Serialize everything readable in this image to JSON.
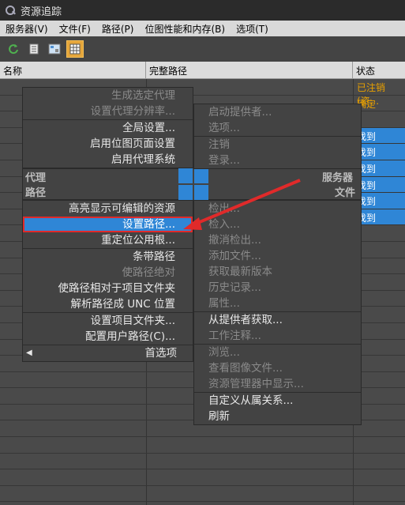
{
  "window": {
    "title": "资源追踪"
  },
  "menu": [
    "服务器(V)",
    "文件(F)",
    "路径(P)",
    "位图性能和内存(B)",
    "选项(T)"
  ],
  "toolbar": [
    "refresh-icon",
    "list-icon",
    "bitmap-icon",
    "table-icon"
  ],
  "columns": {
    "name": "名称",
    "path": "完整路径",
    "status": "状态"
  },
  "row_statuses": [
    "已注销 (资...",
    "确定",
    "",
    "找到",
    "找到",
    "找到",
    "找到",
    "找到",
    "找到"
  ],
  "quad": {
    "top_left_label": "代理",
    "top_right_label": "服务器",
    "bottom_left_label": "路径",
    "bottom_right_label": "文件"
  },
  "left_menu": {
    "items": [
      {
        "label": "生成选定代理",
        "enabled": false
      },
      {
        "label": "设置代理分辨率...",
        "enabled": false
      },
      {
        "sep": true
      },
      {
        "label": "全局设置...",
        "enabled": true
      },
      {
        "label": "启用位图页面设置",
        "enabled": true
      },
      {
        "label": "启用代理系统",
        "enabled": true
      }
    ],
    "items2": [
      {
        "label": "高亮显示可编辑的资源",
        "enabled": true
      },
      {
        "label": "设置路径...",
        "enabled": true,
        "highlight": true
      },
      {
        "label": "重定位公用根...",
        "enabled": true
      },
      {
        "sep": true
      },
      {
        "label": "条带路径",
        "enabled": true
      },
      {
        "label": "使路径绝对",
        "enabled": false
      },
      {
        "label": "使路径相对于项目文件夹",
        "enabled": true
      },
      {
        "label": "解析路径成 UNC 位置",
        "enabled": true
      },
      {
        "sep": true
      },
      {
        "label": "设置项目文件夹...",
        "enabled": true
      },
      {
        "label": "配置用户路径(C)...",
        "enabled": true
      },
      {
        "sep": true
      },
      {
        "label": "首选项",
        "enabled": true,
        "arrow": true
      }
    ]
  },
  "right_menu": {
    "items": [
      {
        "label": "启动提供者...",
        "enabled": false
      },
      {
        "label": "选项...",
        "enabled": false
      },
      {
        "sep": true
      },
      {
        "label": "注销",
        "enabled": false
      },
      {
        "label": "登录...",
        "enabled": false
      }
    ],
    "items2": [
      {
        "label": "检出...",
        "enabled": false
      },
      {
        "label": "检入...",
        "enabled": false
      },
      {
        "label": "撤消检出...",
        "enabled": false
      },
      {
        "label": "添加文件...",
        "enabled": false
      },
      {
        "label": "获取最新版本",
        "enabled": false
      },
      {
        "label": "历史记录...",
        "enabled": false
      },
      {
        "label": "属性...",
        "enabled": false
      },
      {
        "sep": true
      },
      {
        "label": "从提供者获取...",
        "enabled": true
      },
      {
        "label": "工作注释...",
        "enabled": false
      },
      {
        "sep": true
      },
      {
        "label": "浏览...",
        "enabled": false
      },
      {
        "label": "查看图像文件...",
        "enabled": false
      },
      {
        "label": "资源管理器中显示...",
        "enabled": false
      },
      {
        "sep": true
      },
      {
        "label": "自定义从属关系...",
        "enabled": true
      },
      {
        "label": "刷新",
        "enabled": true
      }
    ]
  }
}
